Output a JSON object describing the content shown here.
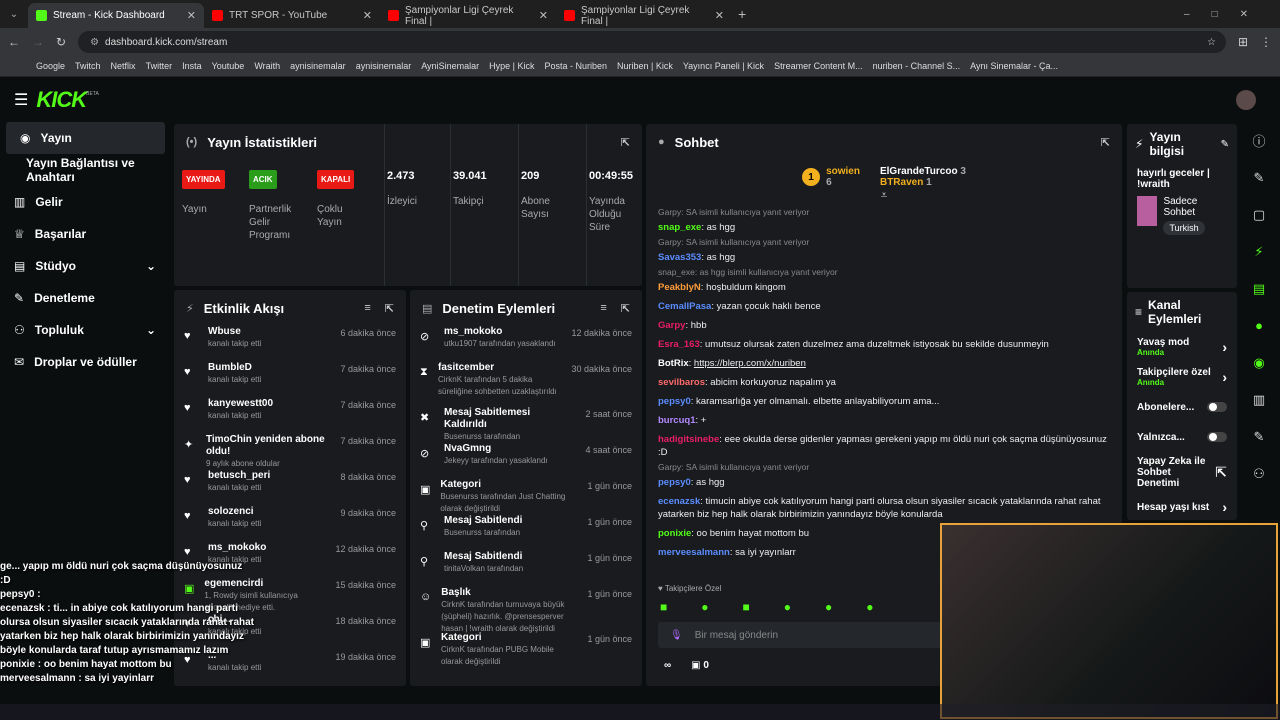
{
  "browser": {
    "tabs": [
      {
        "label": "Stream - Kick Dashboard",
        "color": "#53fc18"
      },
      {
        "label": "TRT SPOR - YouTube",
        "color": "#ff0000"
      },
      {
        "label": "Şampiyonlar Ligi Çeyrek Final |",
        "color": "#ff0000"
      },
      {
        "label": "Şampiyonlar Ligi Çeyrek Final |",
        "color": "#ff0000"
      }
    ],
    "url": "dashboard.kick.com/stream",
    "bookmarks": [
      "Google",
      "Twitch",
      "Netflix",
      "Twitter",
      "Insta",
      "Youtube",
      "Wraith",
      "aynisinemalar",
      "aynisinemalar",
      "AyniSinemalar",
      "Hype | Kick",
      "Posta - Nuriben",
      "Nuriben | Kick",
      "Yayıncı Paneli | Kick",
      "Streamer Content M...",
      "nuriben - Channel S...",
      "Aynı Sinemalar - Ça..."
    ]
  },
  "brand": {
    "logo": "KICK",
    "beta": "BETA",
    "accent": "#53fc18"
  },
  "sidebar": {
    "items": [
      "Yayın",
      "Yayın Bağlantısı ve Anahtarı",
      "Gelir",
      "Başarılar",
      "Stüdyo",
      "Denetleme",
      "Topluluk",
      "Droplar ve ödüller"
    ]
  },
  "stats": {
    "title": "Yayın İstatistikleri",
    "items": [
      {
        "badge": "YAYINDA",
        "badge_color": "#e91916",
        "label": "Yayın"
      },
      {
        "badge": "ACIK",
        "badge_color": "#2a9d1a",
        "label": "Partnerlik Gelir Programı"
      },
      {
        "badge": "KAPALI",
        "badge_color": "#e91916",
        "label": "Çoklu Yayın"
      },
      {
        "value": "2.473",
        "label": "İzleyici"
      },
      {
        "value": "39.041",
        "label": "Takipçi"
      },
      {
        "value": "209",
        "label": "Abone Sayısı"
      },
      {
        "value": "00:49:55",
        "label": "Yayında Olduğu Süre"
      }
    ]
  },
  "activity": {
    "title": "Etkinlik Akışı",
    "items": [
      {
        "name": "Wbuse",
        "sub": "kanalı takip etti",
        "time": "6 dakika önce"
      },
      {
        "name": "BumbleD",
        "sub": "kanalı takip etti",
        "time": "7 dakika önce"
      },
      {
        "name": "kanyewestt00",
        "sub": "kanalı takip etti",
        "time": "7 dakika önce"
      },
      {
        "name": "TimoChin yeniden abone oldu!",
        "sub": "9 aylık abone oldular",
        "time": "7 dakika önce"
      },
      {
        "name": "betusch_peri",
        "sub": "kanalı takip etti",
        "time": "8 dakika önce"
      },
      {
        "name": "solozenci",
        "sub": "kanalı takip etti",
        "time": "9 dakika önce"
      },
      {
        "name": "ms_mokoko",
        "sub": "kanalı takip etti",
        "time": "12 dakika önce"
      },
      {
        "name": "egemencirdi",
        "sub": "1, Rowdy isimli kullanıcıya abonelik hediye etti.",
        "time": "15 dakika önce"
      },
      {
        "name": "chi...",
        "sub": "kanalı takip etti",
        "time": "18 dakika önce"
      },
      {
        "name": "...",
        "sub": "kanalı takip etti",
        "time": "19 dakika önce"
      }
    ]
  },
  "moderation": {
    "title": "Denetim Eylemleri",
    "items": [
      {
        "name": "ms_mokoko",
        "sub": "utku1907 tarafından yasaklandı",
        "time": "12 dakika önce"
      },
      {
        "name": "fasitcember",
        "sub": "CirknK tarafından 5 dakika süreliğine sohbetten uzaklaştırıldı",
        "time": "30 dakika önce"
      },
      {
        "name": "Mesaj Sabitlemesi Kaldırıldı",
        "sub": "Busenurss tarafından",
        "time": "2 saat önce"
      },
      {
        "name": "NvaGmng",
        "sub": "Jekeyy tarafından yasaklandı",
        "time": "4 saat önce"
      },
      {
        "name": "Kategori",
        "sub": "Busenurss tarafından Just Chatting olarak değiştirildi",
        "time": "1 gün önce"
      },
      {
        "name": "Mesaj Sabitlendi",
        "sub": "Busenurss tarafından",
        "time": "1 gün önce"
      },
      {
        "name": "Mesaj Sabitlendi",
        "sub": "tinitaVolkan tarafından",
        "time": "1 gün önce"
      },
      {
        "name": "Başlık",
        "sub": "CirknK tarafından turnuvaya büyük (şüpheli) hazırlık. @prensesperver hasan | !wraith olarak değiştirildi",
        "time": "1 gün önce"
      },
      {
        "name": "Kategori",
        "sub": "CirknK tarafından PUBG Mobile olarak değiştirildi",
        "time": "1 gün önce"
      }
    ]
  },
  "chat": {
    "title": "Sohbet",
    "top": [
      {
        "rank": "1",
        "name": "sowien",
        "count": "6"
      },
      {
        "name": "ElGrandeTurcoo",
        "count": "3"
      },
      {
        "name": "BTRaven",
        "count": "1"
      }
    ],
    "messages": [
      {
        "reply": "Garpy: SA isimli kullanıcıya yanıt veriyor",
        "user": "snap_exe",
        "color": "#53fc18",
        "text": "as hgg"
      },
      {
        "reply": "Garpy: SA isimli kullanıcıya yanıt veriyor",
        "user": "Savas353",
        "color": "#5b8dff",
        "text": "as hgg"
      },
      {
        "reply": "snap_exe: as hgg isimli kullanıcıya yanıt veriyor",
        "user": "PeakblyN",
        "color": "#ff9c3a",
        "text": "hoşbuldum kingom"
      },
      {
        "user": "CemalIPasa",
        "color": "#5b8dff",
        "text": "yazan çocuk haklı bence"
      },
      {
        "user": "Garpy",
        "color": "#e91e63",
        "text": "hbb"
      },
      {
        "user": "Esra_163",
        "color": "#e91e63",
        "text": "umutsuz olursak zaten duzelmez ama duzeltmek istiyosak bu sekilde dusunmeyin"
      },
      {
        "user": "BotRix",
        "color": "#ffffff",
        "text": "https://blerp.com/x/nuriben"
      },
      {
        "user": "sevilbaros",
        "color": "#ff6b6b",
        "text": "abicim korkuyoruz napalım ya"
      },
      {
        "user": "pepsy0",
        "color": "#5b8dff",
        "text": "karamsarlığa yer olmamalı. elbette anlayabiliyorum ama..."
      },
      {
        "user": "burcuq1",
        "color": "#b388ff",
        "text": "+"
      },
      {
        "user": "hadigitsinebe",
        "color": "#e91e63",
        "text": "eee okulda derse gidenler yapması gerekeni yapıp mı öldü nuri çok saçma düşünüyosunuz :D"
      },
      {
        "reply": "Garpy: SA isimli kullanıcıya yanıt veriyor",
        "user": "pepsy0",
        "color": "#5b8dff",
        "text": "as hgg"
      },
      {
        "user": "ecenazsk",
        "color": "#5b8dff",
        "text": "timucin abiye cok katılıyorum hangi parti olursa olsun siyasiler sıcacık yataklarında rahat rahat yatarken biz hep halk olarak birbirimizin yanındayız böyle konularda"
      },
      {
        "user": "ponixie",
        "color": "#53fc18",
        "text": "oo benim hayat mottom bu"
      },
      {
        "user": "merveesalmann",
        "color": "#5b8dff",
        "text": "sa iyi yayınlarr"
      }
    ],
    "follower_label": "Takipçilere Özel",
    "placeholder": "Bir mesaj gönderin",
    "footer_count": "0"
  },
  "stream_info": {
    "title": "Yayın bilgisi",
    "stream_title": "hayırlı geceler | !wraith",
    "category": "Sadece Sohbet",
    "tag": "Turkish"
  },
  "channel_actions": {
    "title": "Kanal Eylemleri",
    "items": [
      {
        "label": "Yavaş mod",
        "sub": "Anında"
      },
      {
        "label": "Takipçilere özel",
        "sub": "Anında"
      },
      {
        "label": "Abonelere..."
      },
      {
        "label": "Yalnızca..."
      },
      {
        "label": "Yapay Zeka ile Sohbet Denetimi"
      },
      {
        "label": "Hesap yaşı kıst"
      }
    ]
  },
  "overlay": {
    "lines": [
      "ge... yapıp mı öldü nuri çok saçma düşünüyosunuz",
      ":D",
      "pepsy0 :",
      "ecenazsk : ti... in abiye cok katılıyorum hangi parti",
      "olursa olsun siyasiler sıcacık yataklarında rahat rahat",
      "yatarken biz hep halk olarak birbirimizin yanındayız",
      "böyle konularda taraf tutup ayrısmamamız lazım",
      "ponixie : oo benim hayat mottom bu",
      "merveesalmann : sa iyi yayinlarr"
    ]
  }
}
